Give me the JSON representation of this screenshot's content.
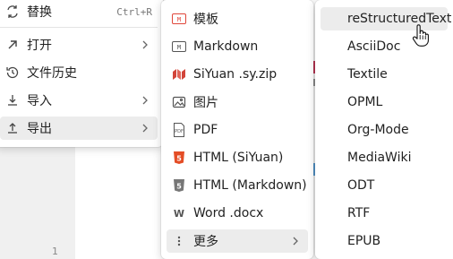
{
  "main_menu": {
    "items": [
      {
        "label": "替换",
        "shortcut": "Ctrl+R",
        "icon": "replace-icon"
      },
      {
        "label": "打开",
        "icon": "open-icon",
        "submenu": true
      },
      {
        "label": "文件历史",
        "icon": "history-icon"
      },
      {
        "label": "导入",
        "icon": "import-icon",
        "submenu": true
      },
      {
        "label": "导出",
        "icon": "export-icon",
        "submenu": true,
        "active": true
      }
    ]
  },
  "export_menu": {
    "items": [
      {
        "label": "模板",
        "icon": "template-icon"
      },
      {
        "label": "Markdown",
        "icon": "markdown-icon"
      },
      {
        "label": "SiYuan .sy.zip",
        "icon": "siyuan-icon"
      },
      {
        "label": "图片",
        "icon": "image-icon"
      },
      {
        "label": "PDF",
        "icon": "pdf-icon"
      },
      {
        "label": "HTML (SiYuan)",
        "icon": "html5-icon"
      },
      {
        "label": "HTML (Markdown)",
        "icon": "html5-gray-icon"
      },
      {
        "label": "Word .docx",
        "icon": "word-icon"
      },
      {
        "label": "更多",
        "icon": "more-icon",
        "submenu": true,
        "active": true
      }
    ]
  },
  "more_menu": {
    "items": [
      {
        "label": "reStructuredText",
        "active": true
      },
      {
        "label": "AsciiDoc"
      },
      {
        "label": "Textile"
      },
      {
        "label": "OPML"
      },
      {
        "label": "Org-Mode"
      },
      {
        "label": "MediaWiki"
      },
      {
        "label": "ODT"
      },
      {
        "label": "RTF"
      },
      {
        "label": "EPUB"
      }
    ]
  },
  "editor": {
    "line_number": "1"
  },
  "colors": {
    "accent_red": "#e0463a",
    "hover_bg": "#ececec"
  }
}
